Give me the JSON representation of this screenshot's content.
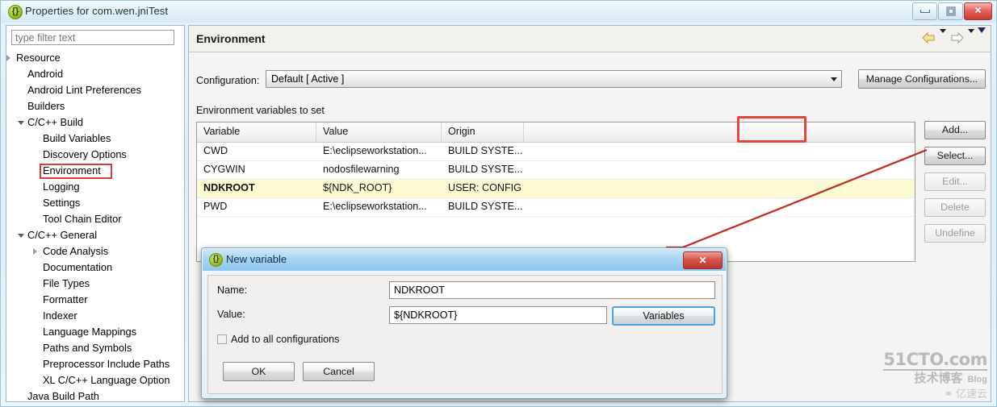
{
  "window": {
    "title": "Properties for com.wen.jniTest",
    "icon": "eclipse-properties-icon",
    "controls": {
      "minimize": "minimize-button",
      "restore": "restore-button",
      "close": "✕"
    }
  },
  "sidebar": {
    "filter_placeholder": "type filter text",
    "filter_value": "",
    "selected": "Environment",
    "items": [
      {
        "label": "Resource",
        "indent": 12,
        "arrow": "closed"
      },
      {
        "label": "Android",
        "indent": 26,
        "arrow": "none"
      },
      {
        "label": "Android Lint Preferences",
        "indent": 26,
        "arrow": "none"
      },
      {
        "label": "Builders",
        "indent": 26,
        "arrow": "none"
      },
      {
        "label": "C/C++ Build",
        "indent": 26,
        "arrow": "open"
      },
      {
        "label": "Build Variables",
        "indent": 45,
        "arrow": "none"
      },
      {
        "label": "Discovery Options",
        "indent": 45,
        "arrow": "none"
      },
      {
        "label": "Environment",
        "indent": 45,
        "arrow": "none"
      },
      {
        "label": "Logging",
        "indent": 45,
        "arrow": "none"
      },
      {
        "label": "Settings",
        "indent": 45,
        "arrow": "none"
      },
      {
        "label": "Tool Chain Editor",
        "indent": 45,
        "arrow": "none"
      },
      {
        "label": "C/C++ General",
        "indent": 26,
        "arrow": "open"
      },
      {
        "label": "Code Analysis",
        "indent": 45,
        "arrow": "closed"
      },
      {
        "label": "Documentation",
        "indent": 45,
        "arrow": "none"
      },
      {
        "label": "File Types",
        "indent": 45,
        "arrow": "none"
      },
      {
        "label": "Formatter",
        "indent": 45,
        "arrow": "none"
      },
      {
        "label": "Indexer",
        "indent": 45,
        "arrow": "none"
      },
      {
        "label": "Language Mappings",
        "indent": 45,
        "arrow": "none"
      },
      {
        "label": "Paths and Symbols",
        "indent": 45,
        "arrow": "none"
      },
      {
        "label": "Preprocessor Include Paths",
        "indent": 45,
        "arrow": "none"
      },
      {
        "label": "XL C/C++ Language Option",
        "indent": 45,
        "arrow": "none"
      },
      {
        "label": "Java Build Path",
        "indent": 26,
        "arrow": "none"
      }
    ]
  },
  "main": {
    "page_title": "Environment",
    "nav": {
      "back": "back-arrow-icon",
      "back_menu": "chevron-down-icon",
      "forward": "forward-arrow-icon",
      "forward_menu": "chevron-down-icon",
      "view_menu": "chevron-down-icon"
    },
    "configuration": {
      "label": "Configuration:",
      "value": "Default  [ Active ]",
      "manage_button": "Manage Configurations..."
    },
    "section_label": "Environment variables to set",
    "table": {
      "columns": [
        "Variable",
        "Value",
        "Origin",
        ""
      ],
      "rows": [
        {
          "variable": "CWD",
          "value": "E:\\eclipseworkstation...",
          "origin": "BUILD SYSTE...",
          "extra": "",
          "highlighted": false
        },
        {
          "variable": "CYGWIN",
          "value": "nodosfilewarning",
          "origin": "BUILD SYSTE...",
          "extra": "",
          "highlighted": false
        },
        {
          "variable": "NDKROOT",
          "value": "${NDK_ROOT}",
          "origin": "USER: CONFIG",
          "extra": "",
          "highlighted": true
        },
        {
          "variable": "PWD",
          "value": "E:\\eclipseworkstation...",
          "origin": "BUILD SYSTE...",
          "extra": "",
          "highlighted": false
        }
      ]
    },
    "side_buttons": [
      {
        "label": "Add...",
        "disabled": false
      },
      {
        "label": "Select...",
        "disabled": false
      },
      {
        "label": "Edit...",
        "disabled": true
      },
      {
        "label": "Delete",
        "disabled": true
      },
      {
        "label": "Undefine",
        "disabled": true
      }
    ]
  },
  "dialog": {
    "title": "New variable",
    "icon": "eclipse-variable-icon",
    "close_label": "✕",
    "name_label": "Name:",
    "name_value": "NDKROOT",
    "value_label": "Value:",
    "value_value": "${NDKROOT}",
    "variables_button": "Variables",
    "checkbox_label": "Add to all configurations",
    "checkbox_checked": false,
    "ok_button": "OK",
    "cancel_button": "Cancel"
  },
  "annotations": {
    "highlight_color": "#e8463a",
    "arrow_color": "#c32a1e",
    "row_highlight_color": "#fdfbd4",
    "focus_color": "#4aa3dd"
  },
  "watermark": {
    "line1": "51CTO.com",
    "line2": "技术博客",
    "line2_suffix": "Blog",
    "line3": "亿速云"
  }
}
